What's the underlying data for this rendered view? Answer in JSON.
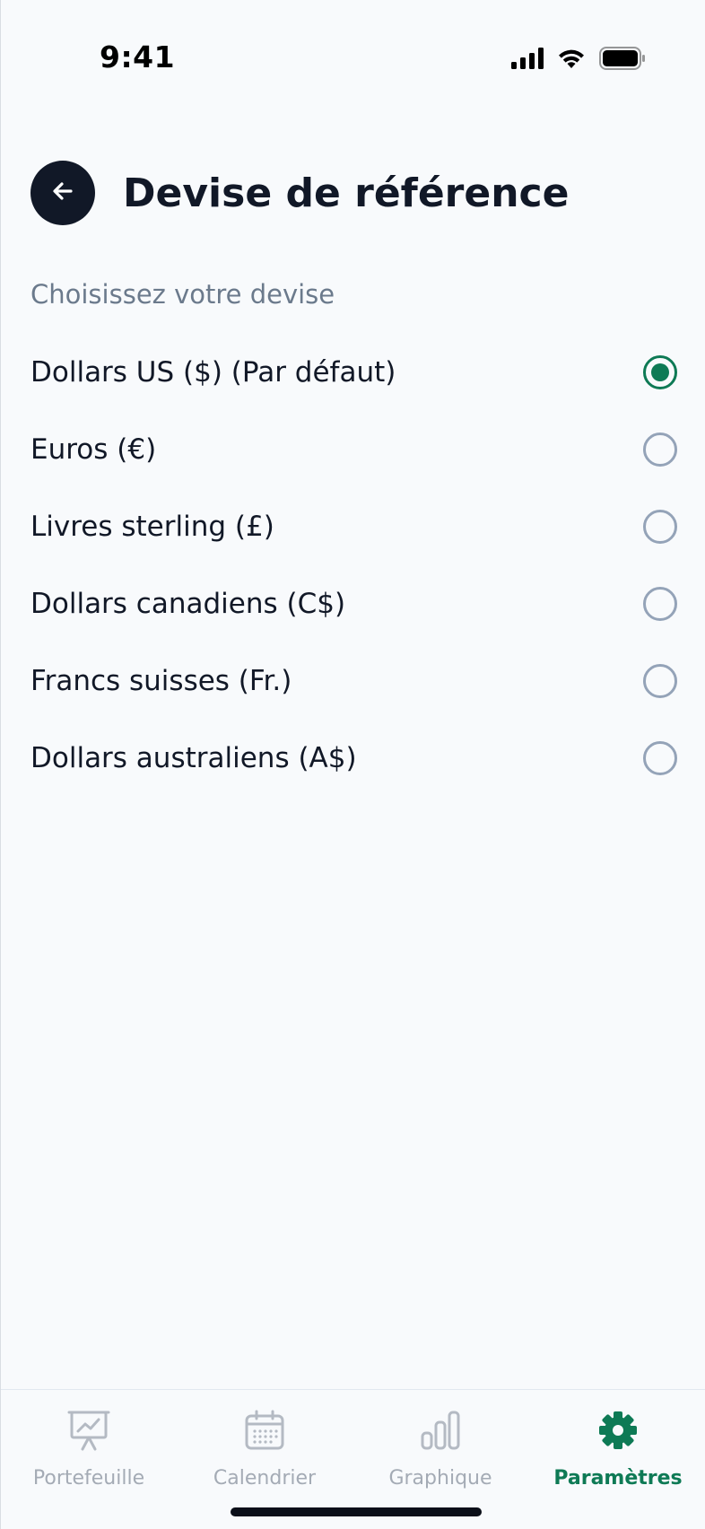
{
  "status_bar": {
    "time": "9:41",
    "icons": [
      "cellular-signal-icon",
      "wifi-icon",
      "battery-icon"
    ]
  },
  "header": {
    "back_icon": "arrow-left-icon",
    "title": "Devise de référence"
  },
  "section_label": "Choisissez votre devise",
  "currency_options": [
    {
      "label": "Dollars US ($) (Par défaut)",
      "selected": true
    },
    {
      "label": "Euros (€)",
      "selected": false
    },
    {
      "label": "Livres sterling (£)",
      "selected": false
    },
    {
      "label": "Dollars canadiens (C$)",
      "selected": false
    },
    {
      "label": "Francs suisses (Fr.)",
      "selected": false
    },
    {
      "label": "Dollars australiens (A$)",
      "selected": false
    }
  ],
  "tab_bar": {
    "tabs": [
      {
        "label": "Portefeuille",
        "icon": "presentation-chart-icon",
        "active": false
      },
      {
        "label": "Calendrier",
        "icon": "calendar-icon",
        "active": false
      },
      {
        "label": "Graphique",
        "icon": "bar-chart-icon",
        "active": false
      },
      {
        "label": "Paramètres",
        "icon": "gear-icon",
        "active": true
      }
    ]
  },
  "colors": {
    "accent": "#0e7a55",
    "inactive": "#a4abb5",
    "text": "#111827",
    "muted": "#6b7a8c",
    "background": "#f8fafc"
  }
}
